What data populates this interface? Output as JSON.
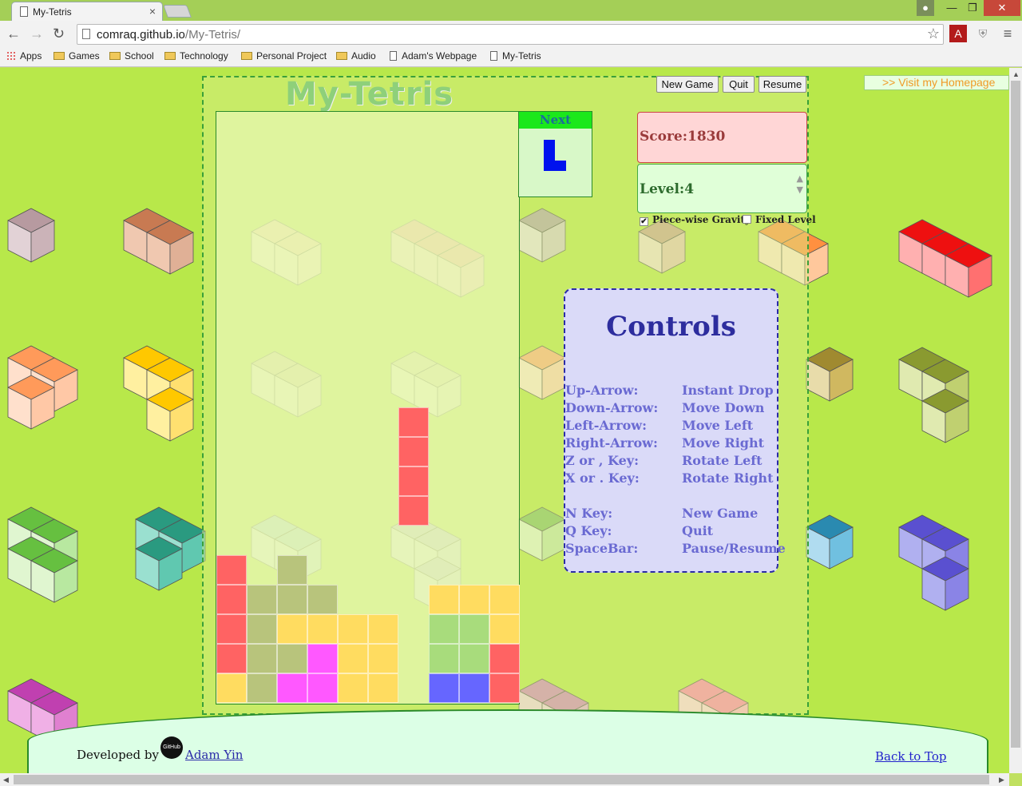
{
  "browser": {
    "tab_title": "My-Tetris",
    "tab_close": "×",
    "url_host": "comraq.github.io",
    "url_path": "/My-Tetris/",
    "bookmarks": [
      "Apps",
      "Games",
      "School",
      "Technology",
      "Personal Project",
      "Audio",
      "Adam's Webpage",
      "My-Tetris"
    ]
  },
  "page": {
    "app_title": "My-Tetris",
    "buttons": {
      "new_game": "New Game",
      "quit": "Quit",
      "resume": "Resume"
    },
    "homepage_link": ">> Visit my Homepage",
    "next_label": "Next",
    "score": "Score:1830",
    "level": "Level:4",
    "options": {
      "gravity": "Piece-wise Gravity",
      "gravity_checked": true,
      "fixed": "Fixed Level",
      "fixed_checked": false
    },
    "controls": {
      "title": "Controls",
      "rows": [
        {
          "key": "Up-Arrow:",
          "action": "Instant Drop"
        },
        {
          "key": "Down-Arrow:",
          "action": "Move Down"
        },
        {
          "key": "Left-Arrow:",
          "action": "Move Left"
        },
        {
          "key": "Right-Arrow:",
          "action": "Move Right"
        },
        {
          "key": "Z or , Key:",
          "action": "Rotate Left"
        },
        {
          "key": "X or . Key:",
          "action": "Rotate Right"
        },
        {
          "key": "N Key:",
          "action": "New Game"
        },
        {
          "key": "Q Key:",
          "action": "Quit"
        },
        {
          "key": "SpaceBar:",
          "action": "Pause/Resume"
        }
      ]
    },
    "footer": {
      "developed_by": "Developed by",
      "developer": "Adam Yin",
      "back_to_top": "Back to Top"
    }
  },
  "colors": {
    "red": "#ff6363",
    "olive": "#b8c47c",
    "yellow": "#ffdc60",
    "magenta": "#ff58ff",
    "green": "#a8dc7c",
    "blue": "#6666ff",
    "next_piece": "#0012ee"
  },
  "board": {
    "columns": 10,
    "rows": 20,
    "falling_piece": {
      "color": "red",
      "cells": [
        [
          6,
          10
        ],
        [
          6,
          11
        ],
        [
          6,
          12
        ],
        [
          6,
          13
        ]
      ]
    },
    "settled": [
      {
        "color": "red",
        "cells": [
          [
            0,
            15
          ],
          [
            0,
            16
          ],
          [
            0,
            17
          ],
          [
            0,
            18
          ]
        ]
      },
      {
        "color": "yellow",
        "cells": [
          [
            0,
            19
          ]
        ]
      },
      {
        "color": "olive",
        "cells": [
          [
            2,
            15
          ],
          [
            1,
            16
          ],
          [
            2,
            16
          ],
          [
            3,
            16
          ],
          [
            1,
            17
          ],
          [
            1,
            18
          ],
          [
            2,
            18
          ],
          [
            1,
            19
          ]
        ]
      },
      {
        "color": "yellow",
        "cells": [
          [
            2,
            17
          ],
          [
            3,
            17
          ],
          [
            4,
            17
          ],
          [
            5,
            17
          ],
          [
            4,
            18
          ],
          [
            5,
            18
          ],
          [
            4,
            19
          ],
          [
            5,
            19
          ]
        ]
      },
      {
        "color": "magenta",
        "cells": [
          [
            3,
            18
          ],
          [
            2,
            19
          ],
          [
            3,
            19
          ]
        ]
      },
      {
        "color": "yellow",
        "cells": [
          [
            7,
            16
          ],
          [
            8,
            16
          ],
          [
            9,
            16
          ],
          [
            9,
            17
          ]
        ]
      },
      {
        "color": "green",
        "cells": [
          [
            7,
            17
          ],
          [
            8,
            17
          ],
          [
            7,
            18
          ],
          [
            8,
            18
          ]
        ]
      },
      {
        "color": "red",
        "cells": [
          [
            9,
            18
          ],
          [
            9,
            19
          ]
        ]
      },
      {
        "color": "blue",
        "cells": [
          [
            7,
            19
          ],
          [
            8,
            19
          ]
        ]
      }
    ]
  },
  "next_piece": {
    "shape": "J",
    "cells": [
      [
        0,
        0
      ],
      [
        0,
        1
      ],
      [
        0,
        2
      ],
      [
        1,
        2
      ]
    ]
  }
}
